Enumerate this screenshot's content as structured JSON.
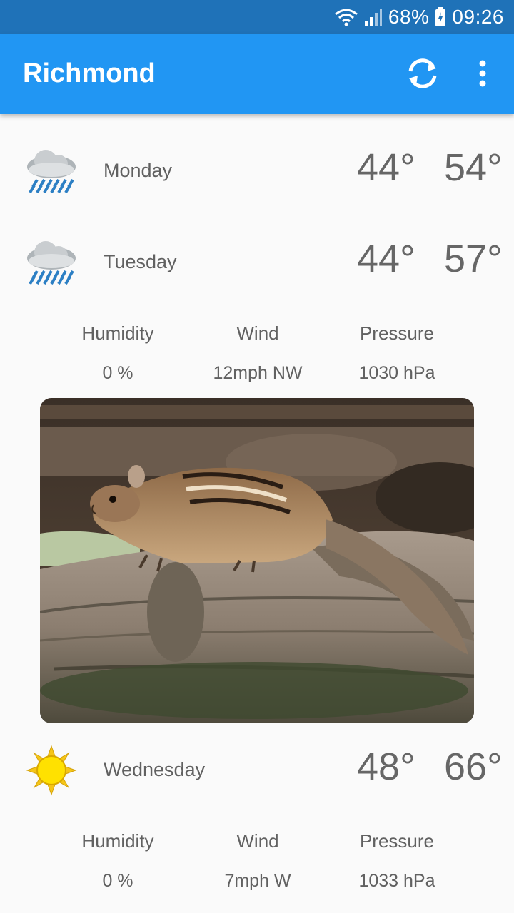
{
  "status_bar": {
    "battery": "68%",
    "time": "09:26"
  },
  "app_bar": {
    "title": "Richmond"
  },
  "days": [
    {
      "name": "Monday",
      "low": "44°",
      "high": "54°",
      "icon": "rain-cloud-icon"
    },
    {
      "name": "Tuesday",
      "low": "44°",
      "high": "57°",
      "icon": "rain-cloud-icon",
      "details": {
        "humidity_label": "Humidity",
        "humidity": "0 %",
        "wind_label": "Wind",
        "wind": "12mph NW",
        "pressure_label": "Pressure",
        "pressure": "1030 hPa"
      }
    },
    {
      "name": "Wednesday",
      "low": "48°",
      "high": "66°",
      "icon": "sun-icon",
      "details": {
        "humidity_label": "Humidity",
        "humidity": "0 %",
        "wind_label": "Wind",
        "wind": "7mph W",
        "pressure_label": "Pressure",
        "pressure": "1033 hPa"
      }
    }
  ],
  "colors": {
    "status_bar": "#1f72b8",
    "app_bar": "#2196f3",
    "background": "#fafafa",
    "text": "#616161"
  }
}
